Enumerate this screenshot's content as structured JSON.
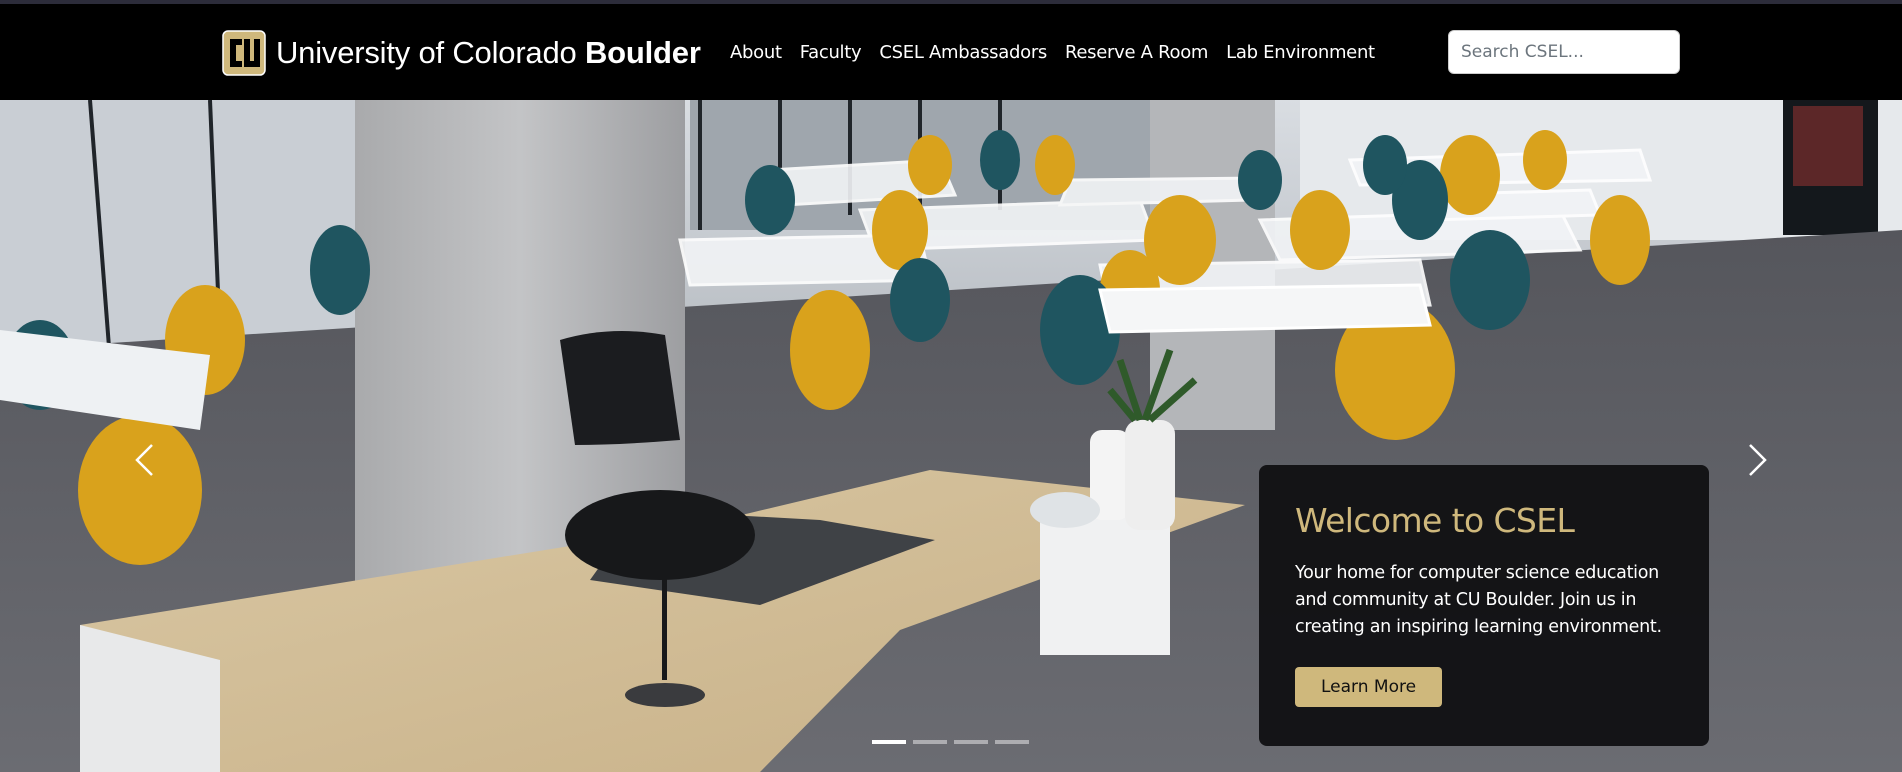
{
  "header": {
    "logo_icon": "cu-boulder-logo-icon",
    "brand_regular": "University of Colorado ",
    "brand_bold": "Boulder",
    "nav": [
      {
        "label": "About"
      },
      {
        "label": "Faculty"
      },
      {
        "label": "CSEL Ambassadors"
      },
      {
        "label": "Reserve A Room"
      },
      {
        "label": "Lab Environment"
      }
    ],
    "search": {
      "placeholder": "Search CSEL..."
    }
  },
  "hero": {
    "prev_icon": "chevron-left-icon",
    "next_icon": "chevron-right-icon",
    "slide_count": 4,
    "active_slide": 1,
    "caption": {
      "title": "Welcome to CSEL",
      "text": "Your home for computer science education and community at CU Boulder. Join us in creating an inspiring learning environment.",
      "button": "Learn More"
    }
  },
  "colors": {
    "gold": "#cfb87c",
    "black": "#000000",
    "chair_yellow": "#d9a21c",
    "chair_teal": "#1f5560"
  }
}
